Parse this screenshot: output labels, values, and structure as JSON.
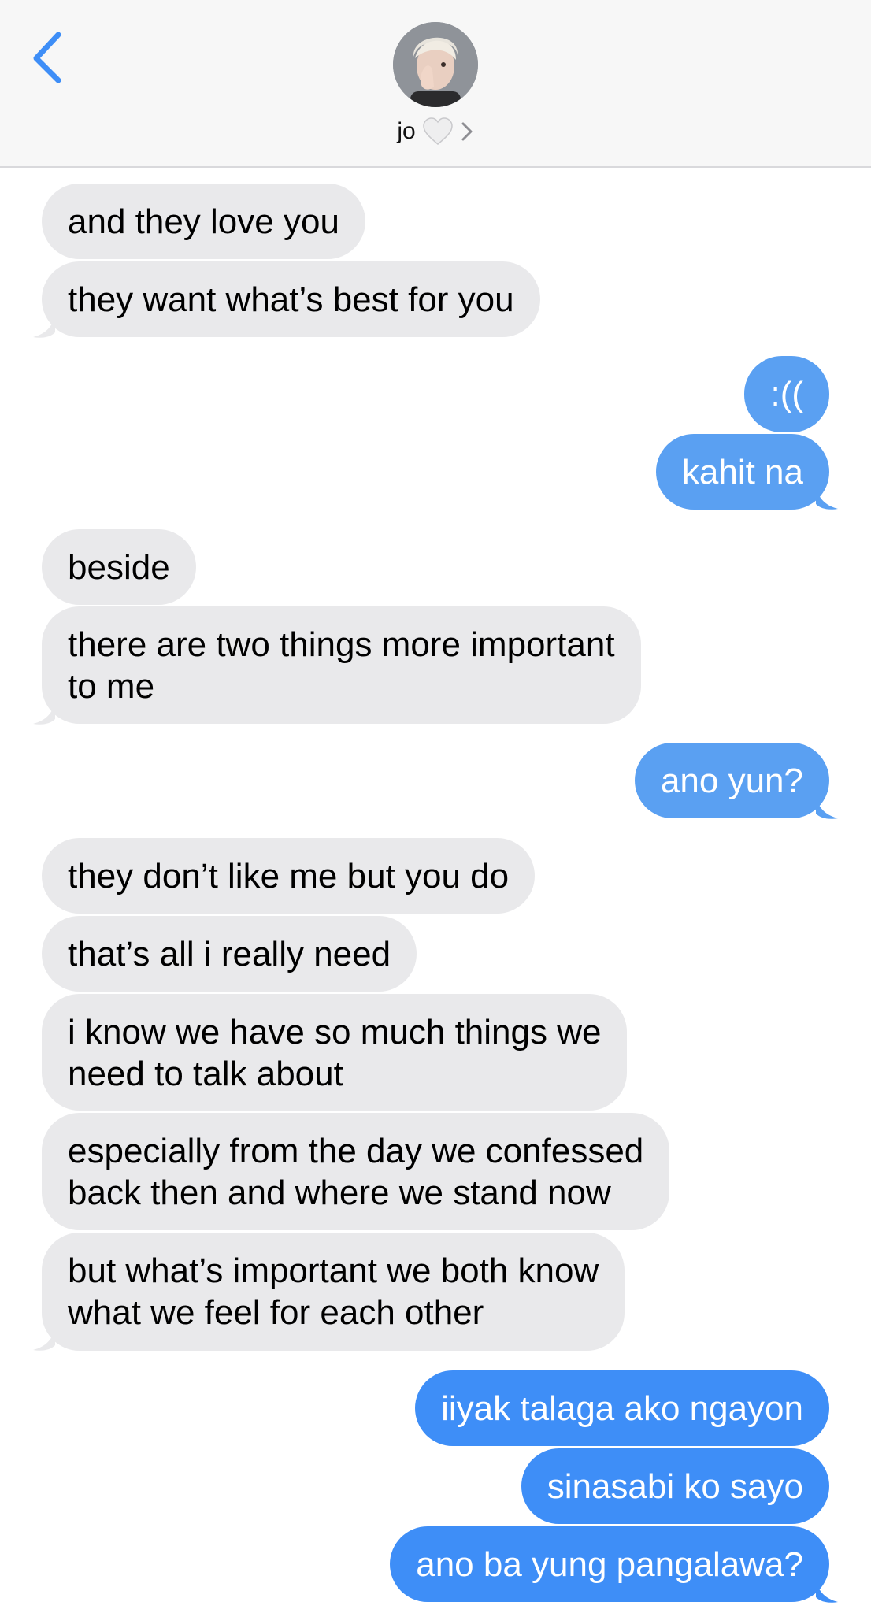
{
  "header": {
    "contact_name": "jo",
    "heart_icon": "white-heart-icon",
    "chevron_icon": "chevron-right-icon",
    "back_icon": "chevron-left-icon",
    "accent_color": "#3e8ef7"
  },
  "messages": [
    {
      "side": "in",
      "text": "and they love you"
    },
    {
      "side": "in",
      "text": "they want what’s best for you"
    },
    {
      "side": "out",
      "text": ":(("
    },
    {
      "side": "out",
      "text": "kahit na"
    },
    {
      "side": "in",
      "text": "beside"
    },
    {
      "side": "in",
      "lines": [
        "there are two things more important",
        "to me"
      ]
    },
    {
      "side": "out",
      "text": "ano yun?"
    },
    {
      "side": "in",
      "text": "they don’t like me but you do"
    },
    {
      "side": "in",
      "text": "that’s all i really need"
    },
    {
      "side": "in",
      "lines": [
        "i know we have so much things we",
        "need to talk about"
      ]
    },
    {
      "side": "in",
      "lines": [
        "especially from the day we confessed",
        "back then and where we stand now"
      ]
    },
    {
      "side": "in",
      "lines": [
        "but what’s important we both know",
        "what we feel for each other"
      ]
    },
    {
      "side": "out",
      "text": "iiyak talaga ako ngayon"
    },
    {
      "side": "out",
      "text": "sinasabi ko sayo"
    },
    {
      "side": "out",
      "text": "ano ba yung pangalawa?"
    }
  ]
}
